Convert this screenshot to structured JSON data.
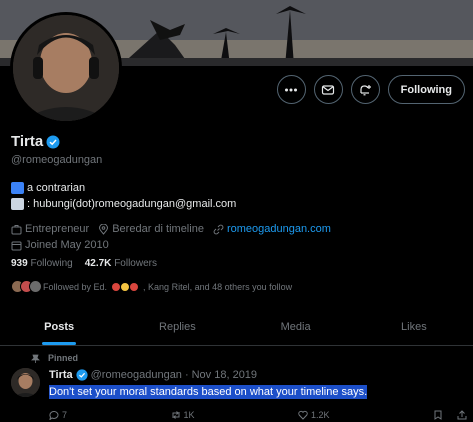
{
  "profile": {
    "name": "Tirta",
    "handle": "@romeogadungan",
    "bio_line1": "a contrarian",
    "bio_line2": ": hubungi(dot)romeogadungan@gmail.com",
    "category": "Entrepreneur",
    "location": "Beredar di timeline",
    "website": "romeogadungan.com",
    "joined": "Joined May 2010",
    "following_count": "939",
    "following_label": "Following",
    "followers_count": "42.7K",
    "followers_label": "Followers",
    "followed_by_prefix": "Followed by Ed.",
    "followed_by_suffix": ", Kang Ritel, and 48 others you follow"
  },
  "actions": {
    "more_icon": "more-icon",
    "message_icon": "mail-icon",
    "notify_icon": "bell-plus-icon",
    "follow_label": "Following"
  },
  "tabs": [
    {
      "label": "Posts",
      "active": true
    },
    {
      "label": "Replies",
      "active": false
    },
    {
      "label": "Media",
      "active": false
    },
    {
      "label": "Likes",
      "active": false
    }
  ],
  "pinned_post": {
    "pinned_label": "Pinned",
    "name": "Tirta",
    "handle": "@romeogadungan",
    "separator": "·",
    "date": "Nov 18, 2019",
    "text": "Don't set your moral standards based on what your timeline says.",
    "replies": "7",
    "reposts": "1K",
    "likes": "1.2K"
  },
  "colors": {
    "accent": "#1d9bf0",
    "background": "#000000",
    "muted": "#71767b",
    "selection": "#1c4fc9"
  }
}
